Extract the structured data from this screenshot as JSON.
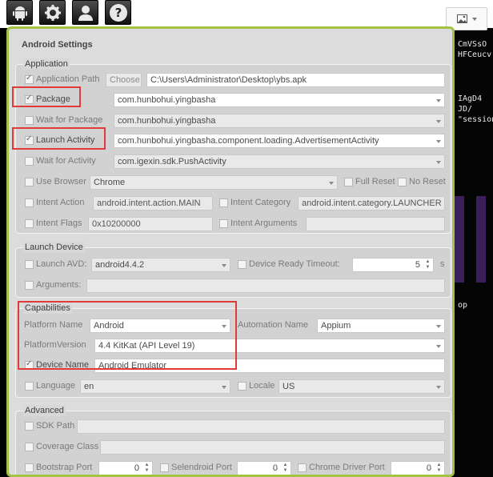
{
  "toolbar": {
    "icons": [
      "android-icon",
      "gear-icon",
      "user-icon",
      "help-icon"
    ],
    "picture_icon": "picture-icon"
  },
  "background": {
    "right_text": [
      "CmVSsO",
      "HFCeucv",
      "",
      "",
      "",
      "IAgD4",
      "JD/",
      "\"session"
    ],
    "op_text": "op"
  },
  "panel": {
    "title": "Android Settings",
    "application": {
      "title": "Application",
      "app_path": {
        "label": "Application Path",
        "checked": true,
        "choose": "Choose",
        "value": "C:\\Users\\Administrator\\Desktop\\ybs.apk"
      },
      "package": {
        "label": "Package",
        "checked": true,
        "value": "com.hunbohui.yingbasha"
      },
      "wait_package": {
        "label": "Wait for Package",
        "checked": false,
        "value": "com.hunbohui.yingbasha"
      },
      "launch_activity": {
        "label": "Launch Activity",
        "checked": true,
        "value": "com.hunbohui.yingbasha.component.loading.AdvertisementActivity"
      },
      "wait_activity": {
        "label": "Wait for Activity",
        "checked": false,
        "value": "com.igexin.sdk.PushActivity"
      },
      "use_browser": {
        "label": "Use Browser",
        "checked": false,
        "value": "Chrome"
      },
      "full_reset": {
        "label": "Full Reset",
        "checked": false
      },
      "no_reset": {
        "label": "No Reset",
        "checked": false
      },
      "intent_action": {
        "label": "Intent Action",
        "checked": false,
        "value": "android.intent.action.MAIN"
      },
      "intent_category": {
        "label": "Intent Category",
        "checked": false,
        "value": "android.intent.category.LAUNCHER"
      },
      "intent_flags": {
        "label": "Intent Flags",
        "checked": false,
        "value": "0x10200000"
      },
      "intent_arguments": {
        "label": "Intent Arguments",
        "checked": false,
        "value": ""
      }
    },
    "launch_device": {
      "title": "Launch Device",
      "launch_avd": {
        "label": "Launch AVD:",
        "checked": false,
        "value": "android4.4.2"
      },
      "device_ready": {
        "label": "Device Ready Timeout:",
        "checked": false,
        "value": "5",
        "unit": "s"
      },
      "arguments": {
        "label": "Arguments:",
        "checked": false,
        "value": ""
      }
    },
    "capabilities": {
      "title": "Capabilities",
      "platform_name": {
        "label": "Platform Name",
        "value": "Android"
      },
      "automation_name": {
        "label": "Automation Name",
        "value": "Appium"
      },
      "platform_version": {
        "label": "PlatformVersion",
        "value": "4.4 KitKat (API Level 19)"
      },
      "device_name": {
        "label": "Device Name",
        "checked": true,
        "value": "Android Emulator"
      },
      "language": {
        "label": "Language",
        "checked": false,
        "value": "en"
      },
      "locale": {
        "label": "Locale",
        "checked": false,
        "value": "US"
      }
    },
    "advanced": {
      "title": "Advanced",
      "sdk_path": {
        "label": "SDK Path",
        "checked": false,
        "value": ""
      },
      "coverage_class": {
        "label": "Coverage Class",
        "checked": false,
        "value": ""
      },
      "bootstrap_port": {
        "label": "Bootstrap Port",
        "checked": false,
        "value": "0"
      },
      "selendroid_port": {
        "label": "Selendroid Port",
        "checked": false,
        "value": "0"
      },
      "chrome_driver_port": {
        "label": "Chrome Driver Port",
        "checked": false,
        "value": "0"
      }
    }
  },
  "colors": {
    "panel_border": "#a3c243",
    "highlight": "#e03a3a"
  }
}
